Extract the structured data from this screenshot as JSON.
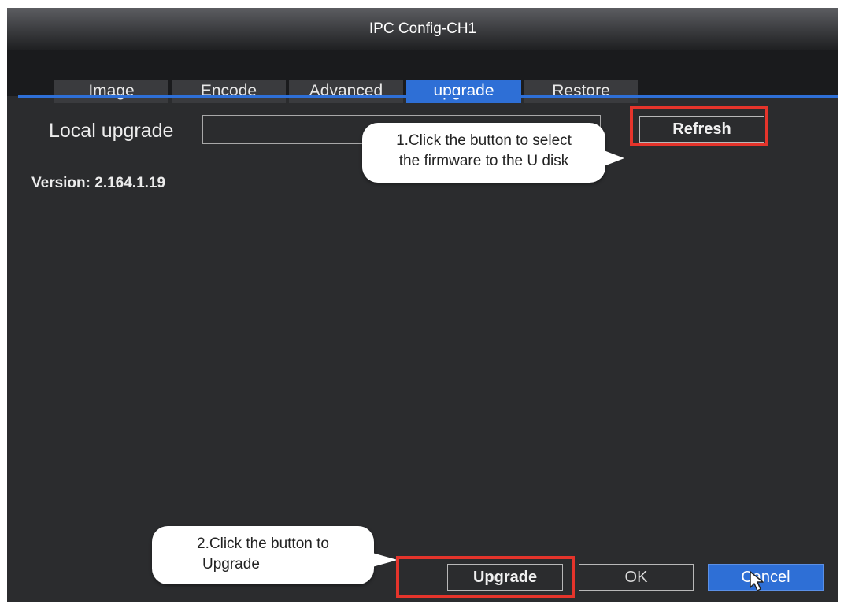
{
  "window": {
    "title": "IPC Config-CH1"
  },
  "tabs": [
    {
      "label": "Image",
      "active": false
    },
    {
      "label": "Encode",
      "active": false
    },
    {
      "label": "Advanced",
      "active": false
    },
    {
      "label": "upgrade",
      "active": true
    },
    {
      "label": "Restore",
      "active": false
    }
  ],
  "local_upgrade": {
    "label": "Local upgrade",
    "file_value": "",
    "refresh_label": "Refresh"
  },
  "version": {
    "text": "Version: 2.164.1.19"
  },
  "callouts": {
    "step1_line1": "1.Click the button to select",
    "step1_line2": "the firmware to the U disk",
    "step2_line1": "2.Click the button to",
    "step2_line2": "Upgrade"
  },
  "footer": {
    "upgrade_label": "Upgrade",
    "ok_label": "OK",
    "cancel_label": "Cancel"
  },
  "colors": {
    "accent": "#2e6fd6",
    "highlight": "#e5342b",
    "panel": "#2b2c2e"
  },
  "icons": {
    "cursor": "mouse-pointer-icon",
    "dropdown": "chevron-down-icon"
  }
}
